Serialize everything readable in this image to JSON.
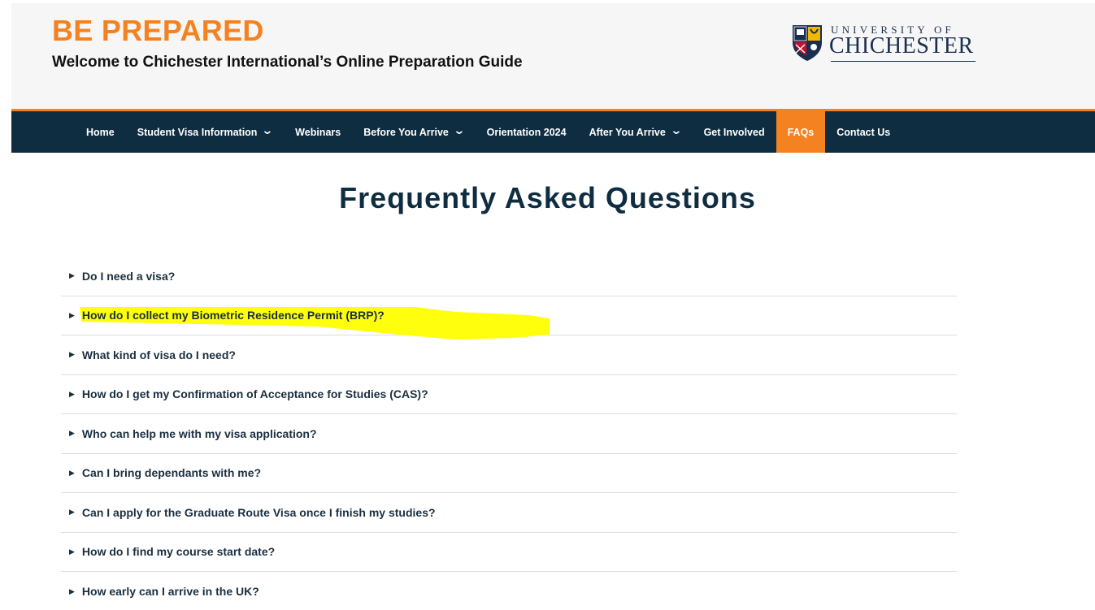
{
  "header": {
    "title": "BE PREPARED",
    "subtitle": "Welcome to Chichester International’s Online Preparation Guide"
  },
  "logo": {
    "top": "UNIVERSITY OF",
    "main": "CHICHESTER"
  },
  "nav": {
    "items": [
      {
        "label": "Home",
        "dropdown": false,
        "active": false
      },
      {
        "label": "Student Visa Information",
        "dropdown": true,
        "active": false
      },
      {
        "label": "Webinars",
        "dropdown": false,
        "active": false
      },
      {
        "label": "Before You Arrive",
        "dropdown": true,
        "active": false
      },
      {
        "label": "Orientation 2024",
        "dropdown": false,
        "active": false
      },
      {
        "label": "After You Arrive",
        "dropdown": true,
        "active": false
      },
      {
        "label": "Get Involved",
        "dropdown": false,
        "active": false
      },
      {
        "label": "FAQs",
        "dropdown": false,
        "active": true
      },
      {
        "label": "Contact Us",
        "dropdown": false,
        "active": false
      }
    ]
  },
  "page": {
    "title": "Frequently Asked Questions"
  },
  "faq": [
    "Do I need a visa?",
    "How do I collect my Biometric Residence Permit (BRP)?",
    "What kind of visa do I need?",
    "How do I get my Confirmation of Acceptance for Studies (CAS)?",
    "Who can help me with my visa application?",
    "Can I bring dependants with me?",
    "Can I apply for the Graduate Route Visa once I finish my studies?",
    "How do I find my course start date?",
    "How early can I arrive in the UK?"
  ],
  "colors": {
    "accent": "#f58220",
    "navy": "#0f2d40",
    "highlighter": "#ffff00"
  },
  "icons": {
    "dropdown": "chevron-down-icon",
    "faq_toggle": "triangle-right-icon",
    "crest": "university-crest-icon"
  }
}
